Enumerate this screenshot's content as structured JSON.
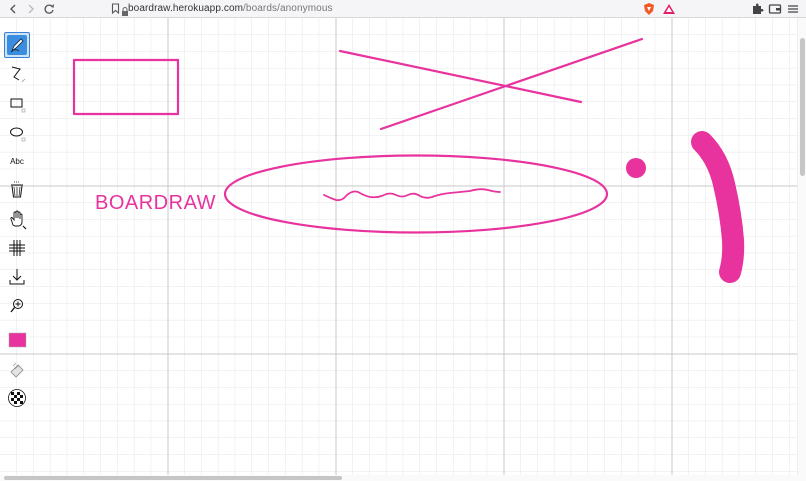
{
  "browser": {
    "url_host": "boardraw.herokuapp.com",
    "url_path": "/boards/anonymous",
    "back_icon": "back-arrow-icon",
    "forward_icon": "forward-arrow-icon",
    "reload_icon": "reload-icon"
  },
  "board": {
    "text_label": "BOARDRAW",
    "ink_color": "#e8339e",
    "grid_color": "#dcdcdc"
  },
  "toolbar": {
    "tools": [
      {
        "name": "pen-tool",
        "icon": "pen-icon",
        "active": true
      },
      {
        "name": "line-tool",
        "icon": "line-icon",
        "active": false
      },
      {
        "name": "rectangle-tool",
        "icon": "rectangle-icon",
        "active": false
      },
      {
        "name": "ellipse-tool",
        "icon": "ellipse-icon",
        "active": false
      },
      {
        "name": "text-tool",
        "icon": "text-icon",
        "label": "Abc",
        "active": false
      },
      {
        "name": "trash-tool",
        "icon": "trash-icon",
        "active": false
      },
      {
        "name": "pan-tool",
        "icon": "hand-icon",
        "active": false
      },
      {
        "name": "grid-tool",
        "icon": "grid-icon",
        "active": false
      },
      {
        "name": "download-tool",
        "icon": "download-icon",
        "active": false
      },
      {
        "name": "zoom-tool",
        "icon": "zoom-icon",
        "active": false
      },
      {
        "name": "color-picker",
        "icon": "color-swatch-icon",
        "active": false
      },
      {
        "name": "eraser-tool",
        "icon": "eraser-icon",
        "active": false
      },
      {
        "name": "background-tool",
        "icon": "checker-icon",
        "active": false
      }
    ],
    "current_color": "#e8339e"
  }
}
